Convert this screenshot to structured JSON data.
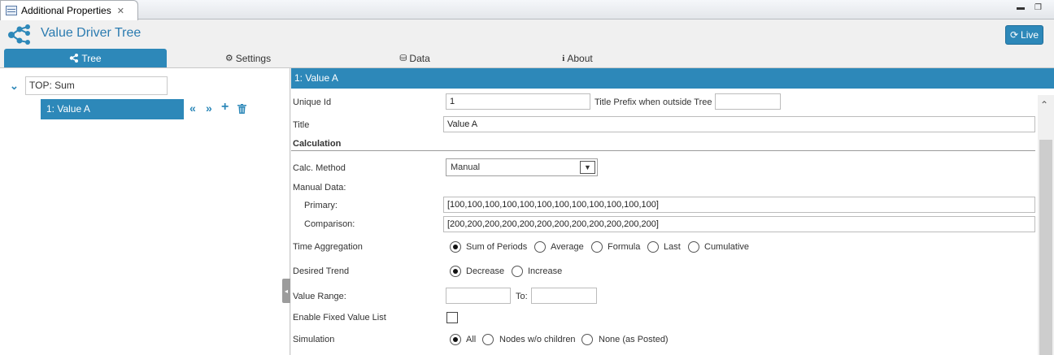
{
  "window": {
    "tab_title": "Additional Properties",
    "close_glyph": "✕",
    "minimize_glyph": "▬",
    "restore_glyph": "❐"
  },
  "header": {
    "app_title": "Value Driver Tree",
    "live_label": "Live",
    "live_icon": "refresh-icon"
  },
  "nav_tabs": [
    {
      "label": "Tree",
      "icon": "share-icon",
      "active": true
    },
    {
      "label": "Settings",
      "icon": "gear-icon",
      "active": false
    },
    {
      "label": "Data",
      "icon": "database-icon",
      "active": false
    },
    {
      "label": "About",
      "icon": "info-icon",
      "active": false
    }
  ],
  "tree": {
    "root_label": "TOP: Sum",
    "child_label": "1: Value A",
    "actions": [
      "move-left-icon",
      "move-right-icon",
      "add-icon",
      "trash-icon"
    ]
  },
  "form": {
    "header": "1: Value A",
    "unique_id_label": "Unique Id",
    "unique_id_value": "1",
    "title_prefix_label": "Title Prefix when outside Tree",
    "title_prefix_value": "",
    "title_label": "Title",
    "title_value": "Value A",
    "calculation_heading": "Calculation",
    "calc_method_label": "Calc. Method",
    "calc_method_value": "Manual",
    "manual_data_label": "Manual Data:",
    "primary_label": "Primary:",
    "primary_value": "[100,100,100,100,100,100,100,100,100,100,100,100]",
    "comparison_label": "Comparison:",
    "comparison_value": "[200,200,200,200,200,200,200,200,200,200,200,200]",
    "time_aggregation_label": "Time Aggregation",
    "time_aggregation_options": [
      "Sum of Periods",
      "Average",
      "Formula",
      "Last",
      "Cumulative"
    ],
    "time_aggregation_selected": "Sum of Periods",
    "desired_trend_label": "Desired Trend",
    "desired_trend_options": [
      "Decrease",
      "Increase"
    ],
    "desired_trend_selected": "Decrease",
    "value_range_label": "Value Range:",
    "value_range_from": "",
    "value_range_to_label": "To:",
    "value_range_to": "",
    "fixed_value_list_label": "Enable Fixed Value List",
    "fixed_value_list_checked": false,
    "simulation_label": "Simulation",
    "simulation_options": [
      "All",
      "Nodes w/o children",
      "None (as Posted)"
    ],
    "simulation_selected": "All"
  },
  "colors": {
    "accent": "#2d88b9",
    "title_blue": "#2b7bb0"
  }
}
